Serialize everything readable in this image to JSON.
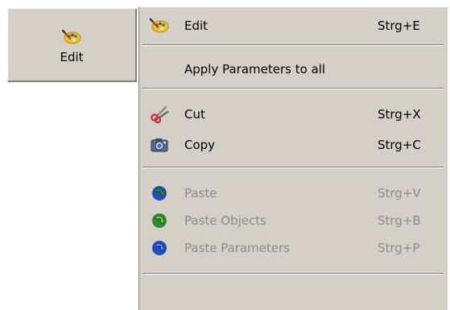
{
  "toolbar": {
    "edit_button": {
      "label": "Edit",
      "icon": "palette-icon"
    }
  },
  "menu": {
    "items": [
      {
        "label": "Edit",
        "shortcut": "Strg+E",
        "icon": "palette-icon",
        "enabled": true
      },
      {
        "label": "Apply Parameters to all",
        "shortcut": "",
        "icon": "",
        "enabled": true
      },
      {
        "label": "Cut",
        "shortcut": "Strg+X",
        "icon": "scissors-icon",
        "enabled": true
      },
      {
        "label": "Copy",
        "shortcut": "Strg+C",
        "icon": "camera-icon",
        "enabled": true
      },
      {
        "label": "Paste",
        "shortcut": "Strg+V",
        "icon": "paste-arrow-icon",
        "enabled": false
      },
      {
        "label": "Paste Objects",
        "shortcut": "Strg+B",
        "icon": "paste-objects-arrow-icon",
        "enabled": false
      },
      {
        "label": "Paste Parameters",
        "shortcut": "Strg+P",
        "icon": "paste-parameters-arrow-icon",
        "enabled": false
      }
    ]
  },
  "colors": {
    "menu_background": "#d4d0c8",
    "disabled_text": "#8c8c8c",
    "palette_yellow": "#f2c12e",
    "arrow_green": "#2e8b2e",
    "arrow_blue": "#1f4fbf"
  }
}
